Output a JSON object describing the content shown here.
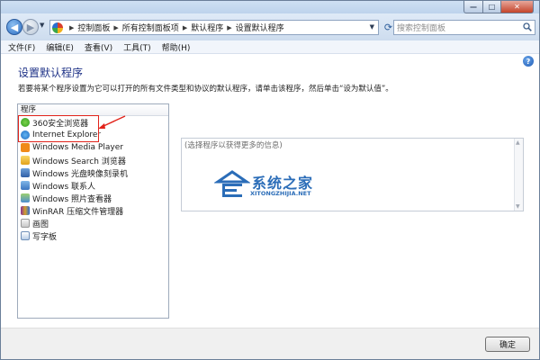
{
  "window": {
    "caption_buttons": {
      "minimize": "—",
      "maximize": "□",
      "close": "✕"
    }
  },
  "navigation": {
    "breadcrumbs": [
      "控制面板",
      "所有控制面板项",
      "默认程序",
      "设置默认程序"
    ],
    "search_placeholder": "搜索控制面板"
  },
  "menu": [
    "文件(F)",
    "编辑(E)",
    "查看(V)",
    "工具(T)",
    "帮助(H)"
  ],
  "page": {
    "title": "设置默认程序",
    "description": "若要将某个程序设置为它可以打开的所有文件类型和协议的默认程序，请单击该程序，然后单击“设为默认值”。"
  },
  "program_list": {
    "header": "程序",
    "items": [
      {
        "label": "360安全浏览器",
        "icon": "360-browser-icon"
      },
      {
        "label": "Internet Explorer",
        "icon": "ie-icon"
      },
      {
        "label": "Windows Media Player",
        "icon": "wmp-icon"
      },
      {
        "label": "Windows Search 浏览器",
        "icon": "windows-search-icon"
      },
      {
        "label": "Windows 光盘映像刻录机",
        "icon": "disc-burner-icon"
      },
      {
        "label": "Windows 联系人",
        "icon": "contacts-icon"
      },
      {
        "label": "Windows 照片查看器",
        "icon": "photo-viewer-icon"
      },
      {
        "label": "WinRAR 压缩文件管理器",
        "icon": "winrar-icon"
      },
      {
        "label": "画图",
        "icon": "paint-icon"
      },
      {
        "label": "写字板",
        "icon": "wordpad-icon"
      }
    ]
  },
  "info_panel": {
    "placeholder": "(选择程序以获得更多的信息)"
  },
  "watermark": {
    "text": "系统之家",
    "subtext": "XITONGZHIJIA.NET"
  },
  "actions": {
    "ok_label": "确定"
  },
  "colors": {
    "title": "#1e3287",
    "highlight": "#e2231a",
    "watermark": "#2b6db8"
  }
}
